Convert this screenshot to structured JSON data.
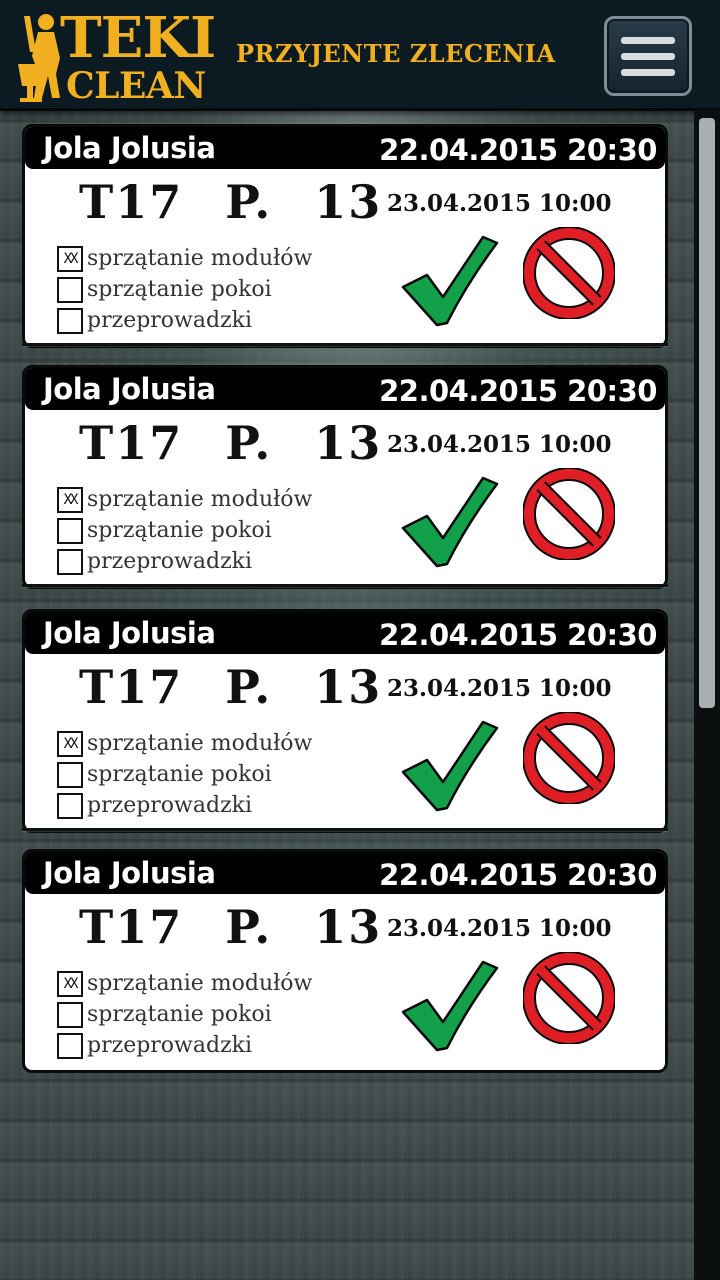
{
  "header": {
    "logo_top": "TEKI",
    "logo_bottom": "CLEAN",
    "title": "PRZYJENTE ZLECENIA",
    "menu_icon": "hamburger-menu-icon"
  },
  "orders": [
    {
      "client": "Jola Jolusia",
      "received": "22.04.2015 20:30",
      "location": "T17 P. 13",
      "scheduled": "23.04.2015 10:00",
      "services": [
        {
          "label": "sprzątanie modułów",
          "mark": "XX",
          "checked": true
        },
        {
          "label": "sprzątanie pokoi",
          "mark": "",
          "checked": false
        },
        {
          "label": "przeprowadzki",
          "mark": "",
          "checked": false
        }
      ],
      "accept_icon": "green-check-icon",
      "reject_icon": "red-prohibited-icon"
    },
    {
      "client": "Jola Jolusia",
      "received": "22.04.2015 20:30",
      "location": "T17 P. 13",
      "scheduled": "23.04.2015 10:00",
      "services": [
        {
          "label": "sprzątanie modułów",
          "mark": "XX",
          "checked": true
        },
        {
          "label": "sprzątanie pokoi",
          "mark": "",
          "checked": false
        },
        {
          "label": "przeprowadzki",
          "mark": "",
          "checked": false
        }
      ],
      "accept_icon": "green-check-icon",
      "reject_icon": "red-prohibited-icon"
    },
    {
      "client": "Jola Jolusia",
      "received": "22.04.2015 20:30",
      "location": "T17 P. 13",
      "scheduled": "23.04.2015 10:00",
      "services": [
        {
          "label": "sprzątanie modułów",
          "mark": "XX",
          "checked": true
        },
        {
          "label": "sprzątanie pokoi",
          "mark": "",
          "checked": false
        },
        {
          "label": "przeprowadzki",
          "mark": "",
          "checked": false
        }
      ],
      "accept_icon": "green-check-icon",
      "reject_icon": "red-prohibited-icon"
    },
    {
      "client": "Jola Jolusia",
      "received": "22.04.2015 20:30",
      "location": "T17 P. 13",
      "scheduled": "23.04.2015 10:00",
      "services": [
        {
          "label": "sprzątanie modułów",
          "mark": "XX",
          "checked": true
        },
        {
          "label": "sprzątanie pokoi",
          "mark": "",
          "checked": false
        },
        {
          "label": "przeprowadzki",
          "mark": "",
          "checked": false
        }
      ],
      "accept_icon": "green-check-icon",
      "reject_icon": "red-prohibited-icon"
    }
  ],
  "colors": {
    "header_bg": "#0c1a22",
    "brand_gold": "#f0b020",
    "accept_green": "#13a04a",
    "reject_red": "#e01e26"
  }
}
